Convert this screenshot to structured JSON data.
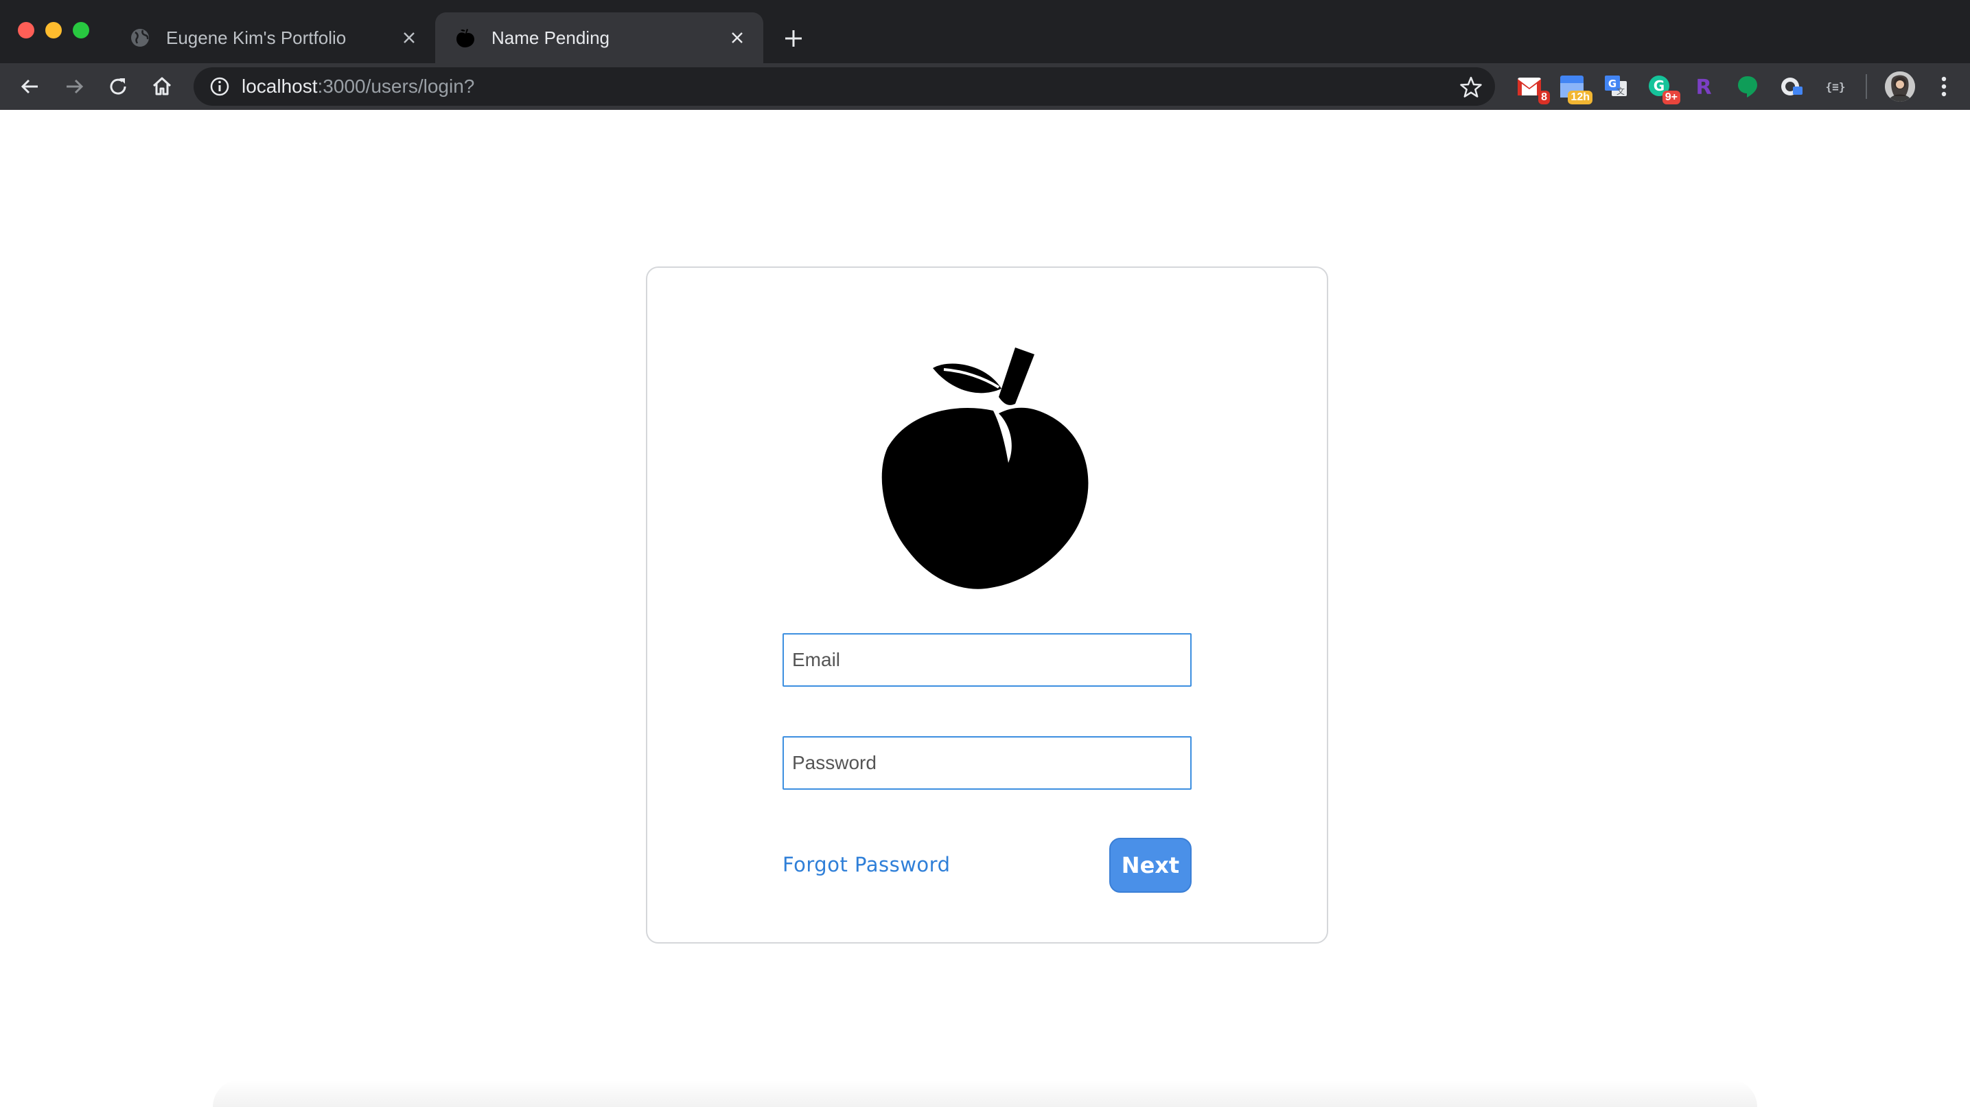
{
  "browser": {
    "tabs": [
      {
        "title": "Eugene Kim's Portfolio",
        "active": false,
        "favicon": "globe-icon"
      },
      {
        "title": "Name Pending",
        "active": true,
        "favicon": "apple-icon"
      }
    ],
    "url_host": "localhost",
    "url_path": ":3000/users/login?",
    "extensions": [
      {
        "name": "gmail-extension-icon",
        "badge": "8",
        "badge_color": "#d93025"
      },
      {
        "name": "calendar-extension-icon",
        "badge": "12h",
        "badge_color": "#f2b632"
      },
      {
        "name": "translate-extension-icon",
        "badge": ""
      },
      {
        "name": "grammarly-extension-icon",
        "badge": "9+",
        "badge_color": "#e8453c"
      },
      {
        "name": "r-extension-icon",
        "badge": ""
      },
      {
        "name": "hangouts-extension-icon",
        "badge": ""
      },
      {
        "name": "lastpass-extension-icon",
        "badge": ""
      },
      {
        "name": "json-extension-icon",
        "badge": ""
      }
    ]
  },
  "login": {
    "logo": "apple-icon",
    "email_placeholder": "Email",
    "password_placeholder": "Password",
    "forgot_label": "Forgot Password",
    "next_label": "Next"
  },
  "colors": {
    "accent": "#4a90e8",
    "link": "#2f7fd8",
    "input_border": "#3d8fe0",
    "chrome_bg": "#202124",
    "toolbar_bg": "#35363a"
  }
}
